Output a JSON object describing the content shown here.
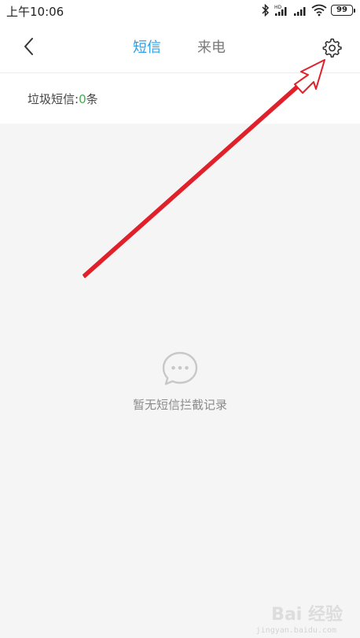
{
  "status_bar": {
    "time": "上午10:06",
    "battery": "99"
  },
  "header": {
    "tabs": [
      {
        "label": "短信",
        "active": true
      },
      {
        "label": "来电",
        "active": false
      }
    ]
  },
  "spam_count": {
    "label": "垃圾短信:",
    "value": "0",
    "unit": "条"
  },
  "empty_state": {
    "message": "暂无短信拦截记录"
  },
  "watermark": {
    "brand": "Bai 经验",
    "site": "jingyan.baidu.com"
  },
  "colors": {
    "accent": "#2b9fe6",
    "count": "#3bb04a",
    "annotation": "#e0202a",
    "background": "#f5f5f5"
  }
}
